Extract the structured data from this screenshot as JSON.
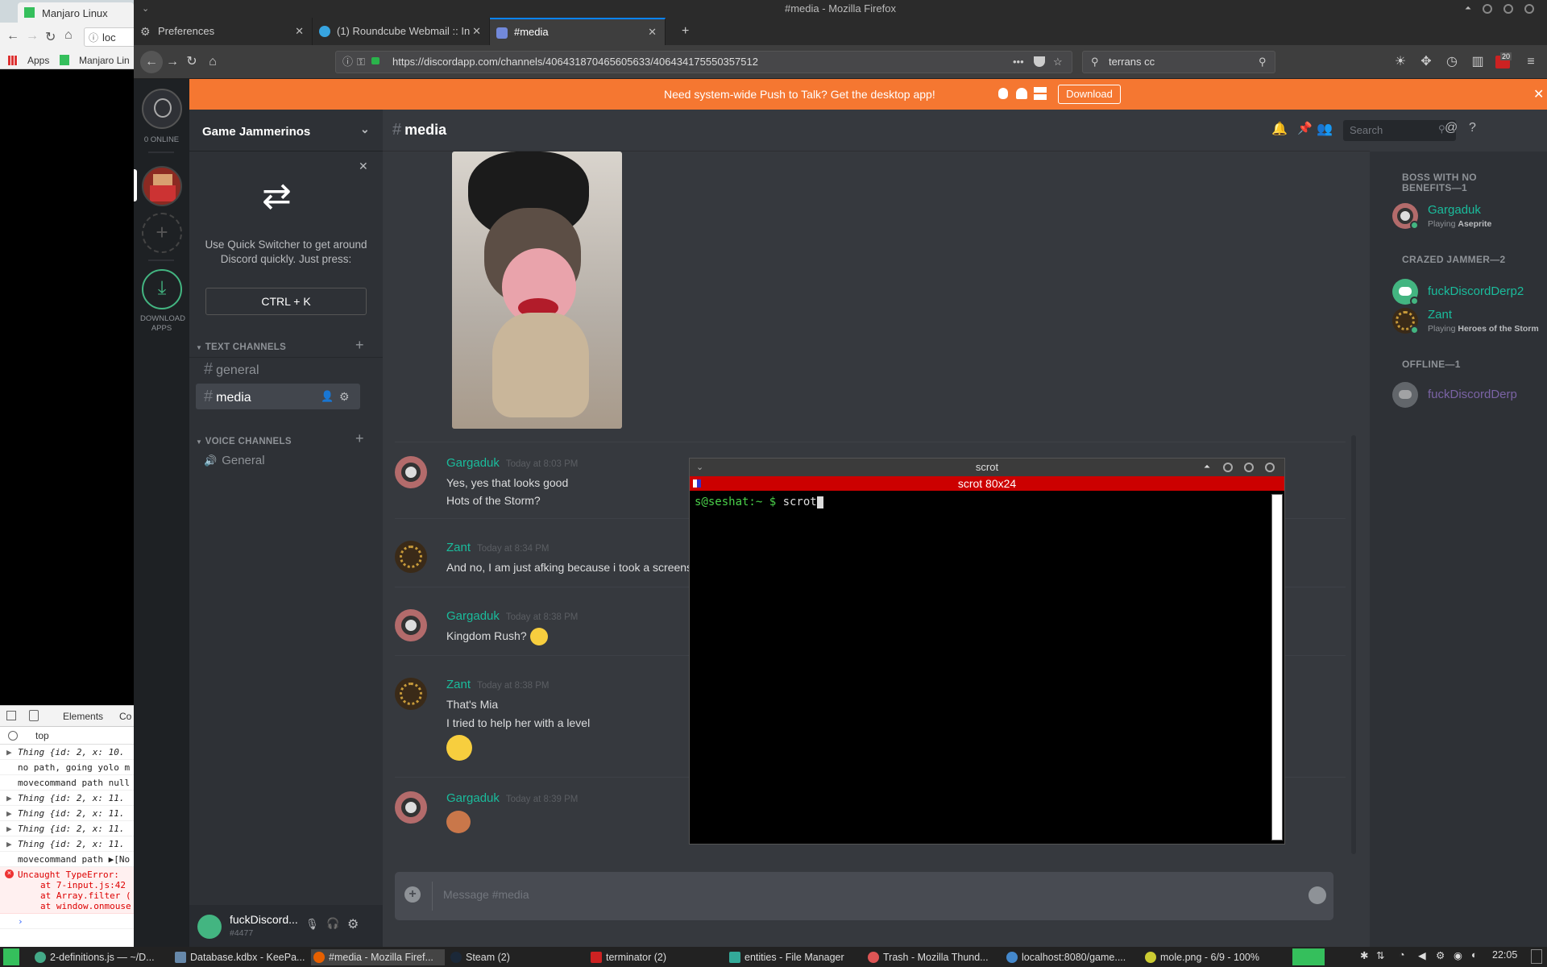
{
  "chrome": {
    "tab_title": "Manjaro Linux",
    "url_partial": "loc",
    "bookmarks": [
      "Apps",
      "Manjaro Lin"
    ],
    "devtools": {
      "tabs": [
        "Elements",
        "Co"
      ],
      "context": "top",
      "lines": [
        {
          "expand": true,
          "text": "Thing {id: 2, x: 10."
        },
        {
          "expand": false,
          "text": "no path, going yolo m"
        },
        {
          "expand": false,
          "text": "movecommand path null"
        },
        {
          "expand": true,
          "text": "Thing {id: 2, x: 11."
        },
        {
          "expand": true,
          "text": "Thing {id: 2, x: 11."
        },
        {
          "expand": true,
          "text": "Thing {id: 2, x: 11."
        },
        {
          "expand": true,
          "text": "Thing {id: 2, x: 11."
        },
        {
          "expand": false,
          "text": "movecommand path ▶[No"
        }
      ],
      "error": [
        "Uncaught TypeError:",
        "at 7-input.js:42",
        "at Array.filter (",
        "at window.onmouse"
      ],
      "prompt": "›"
    }
  },
  "firefox": {
    "window_title": "#media - Mozilla Firefox",
    "tabs": [
      {
        "label": "Preferences",
        "active": false
      },
      {
        "label": "(1) Roundcube Webmail :: In",
        "active": false
      },
      {
        "label": "#media",
        "active": true
      }
    ],
    "url": "https://discordapp.com/channels/406431870465605633/406434175550357512",
    "search_value": "terrans cc",
    "notif_count": "20"
  },
  "discord": {
    "banner": {
      "text": "Need system-wide Push to Talk? Get the desktop app!",
      "download": "Download"
    },
    "guilds": {
      "online": "0 ONLINE",
      "download_apps": "DOWNLOAD APPS"
    },
    "guild_name": "Game Jammerinos",
    "quick_switcher": {
      "text": "Use Quick Switcher to get around Discord quickly. Just press:",
      "shortcut": "CTRL + K"
    },
    "text_channels_label": "TEXT CHANNELS",
    "voice_channels_label": "VOICE CHANNELS",
    "text_channels": [
      "general",
      "media"
    ],
    "voice_channels": [
      "General"
    ],
    "user": {
      "name": "fuckDiscord...",
      "tag": "#4477"
    },
    "channel_name": "media",
    "header_search": "Search",
    "messages": [
      {
        "author": "Gargaduk",
        "time": "Today at 8:03 PM",
        "lines": [
          "Yes, yes that looks good",
          "Hots of the Storm?"
        ]
      },
      {
        "author": "Zant",
        "time": "Today at 8:34 PM",
        "lines": [
          "And no, I am just afking because i took a screenshot"
        ]
      },
      {
        "author": "Gargaduk",
        "time": "Today at 8:38 PM",
        "lines": [
          "Kingdom Rush?"
        ]
      },
      {
        "author": "Zant",
        "time": "Today at 8:38 PM",
        "lines": [
          "That's Mia",
          "I tried to help her with a level"
        ]
      },
      {
        "author": "Gargaduk",
        "time": "Today at 8:39 PM",
        "lines": []
      }
    ],
    "composer_placeholder": "Message #media",
    "members": {
      "cat1": "BOSS WITH NO BENEFITS—1",
      "cat2": "CRAZED JAMMER—2",
      "cat3": "OFFLINE—1",
      "list": [
        {
          "name": "Gargaduk",
          "playing_prefix": "Playing",
          "game": "Aseprite"
        },
        {
          "name": "fuckDiscordDerp2",
          "playing_prefix": "",
          "game": ""
        },
        {
          "name": "Zant",
          "playing_prefix": "Playing",
          "game": "Heroes of the Storm"
        },
        {
          "name": "fuckDiscordDerp",
          "playing_prefix": "",
          "game": ""
        }
      ]
    }
  },
  "terminal": {
    "title": "scrot",
    "subtitle": "scrot 80x24",
    "prompt": "s@seshat:~ $ ",
    "command": "scrot"
  },
  "taskbar": {
    "items": [
      "2-definitions.js — ~/D...",
      "Database.kdbx - KeePa...",
      "#media - Mozilla Firef...",
      "Steam (2)",
      "terminator (2)",
      "entities - File Manager",
      "Trash - Mozilla Thund...",
      "localhost:8080/game....",
      "mole.png - 6/9 - 100%"
    ],
    "clock": "22:05"
  },
  "colors": {
    "discord_green": "#1abc9c",
    "banner": "#f57731",
    "terminal_title": "#cc0000",
    "offline_name": "#7f5ba6"
  }
}
